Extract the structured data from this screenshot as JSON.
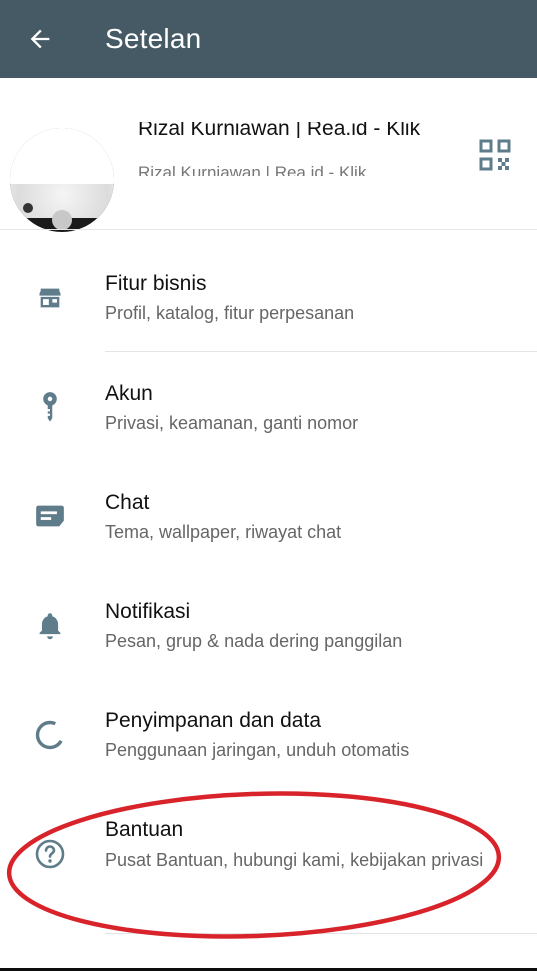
{
  "appbar": {
    "title": "Setelan",
    "background": "#455a64"
  },
  "profile": {
    "name": "Rizal Kurniawan | Rea.id - Klik",
    "status": "Rizal Kurniawan | Rea.id - Klik"
  },
  "settings": [
    {
      "title": "Fitur bisnis",
      "subtitle": "Profil, katalog, fitur perpesanan",
      "icon": "store-icon"
    },
    {
      "title": "Akun",
      "subtitle": "Privasi, keamanan, ganti nomor",
      "icon": "key-icon"
    },
    {
      "title": "Chat",
      "subtitle": "Tema, wallpaper, riwayat chat",
      "icon": "chat-icon"
    },
    {
      "title": "Notifikasi",
      "subtitle": "Pesan, grup & nada dering panggilan",
      "icon": "bell-icon"
    },
    {
      "title": "Penyimpanan dan data",
      "subtitle": "Penggunaan jaringan, unduh otomatis",
      "icon": "storage-icon"
    },
    {
      "title": "Bantuan",
      "subtitle": "Pusat Bantuan, hubungi kami, kebijakan privasi",
      "icon": "help-icon"
    }
  ],
  "colors": {
    "icon": "#5f7c8a",
    "highlight": "#d8232a"
  }
}
